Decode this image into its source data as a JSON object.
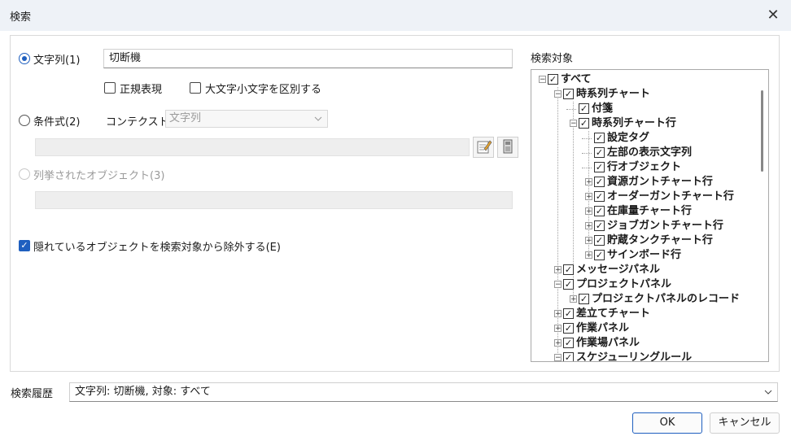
{
  "window": {
    "title": "検索",
    "close_glyph": "✕"
  },
  "search": {
    "string_label": "文字列(1)",
    "string_value": "切断機",
    "regex_label": "正規表現",
    "case_label": "大文字小文字を区別する",
    "condition_label": "条件式(2)",
    "context_label": "コンテクスト",
    "context_value": "文字列",
    "enumerated_label": "列挙されたオブジェクト(3)",
    "hidden_label": "隠れているオブジェクトを検索対象から除外する(E)"
  },
  "target": {
    "heading": "検索対象",
    "items": [
      {
        "label": "すべて",
        "level": 0,
        "expander": "minus"
      },
      {
        "label": "時系列チャート",
        "level": 1,
        "expander": "minus"
      },
      {
        "label": "付箋",
        "level": 2,
        "expander": "none"
      },
      {
        "label": "時系列チャート行",
        "level": 2,
        "expander": "minus"
      },
      {
        "label": "設定タグ",
        "level": 3,
        "expander": "none"
      },
      {
        "label": "左部の表示文字列",
        "level": 3,
        "expander": "none"
      },
      {
        "label": "行オブジェクト",
        "level": 3,
        "expander": "none"
      },
      {
        "label": "資源ガントチャート行",
        "level": 3,
        "expander": "plus"
      },
      {
        "label": "オーダーガントチャート行",
        "level": 3,
        "expander": "plus"
      },
      {
        "label": "在庫量チャート行",
        "level": 3,
        "expander": "plus"
      },
      {
        "label": "ジョブガントチャート行",
        "level": 3,
        "expander": "plus"
      },
      {
        "label": "貯蔵タンクチャート行",
        "level": 3,
        "expander": "plus"
      },
      {
        "label": "サインボード行",
        "level": 3,
        "expander": "plus"
      },
      {
        "label": "メッセージパネル",
        "level": 1,
        "expander": "plus"
      },
      {
        "label": "プロジェクトパネル",
        "level": 1,
        "expander": "minus"
      },
      {
        "label": "プロジェクトパネルのレコード",
        "level": 2,
        "expander": "plus"
      },
      {
        "label": "差立てチャート",
        "level": 1,
        "expander": "plus"
      },
      {
        "label": "作業パネル",
        "level": 1,
        "expander": "plus"
      },
      {
        "label": "作業場パネル",
        "level": 1,
        "expander": "plus"
      },
      {
        "label": "スケジューリングルール",
        "level": 1,
        "expander": "minus"
      }
    ]
  },
  "history": {
    "label": "検索履歴",
    "value": "文字列: 切断機, 対象: すべて"
  },
  "buttons": {
    "ok": "OK",
    "cancel": "キャンセル"
  },
  "colors": {
    "accent": "#1f5fbf",
    "titlebar": "#eef2f7"
  },
  "icons": {
    "edit": "edit-icon",
    "object_select": "object-select-icon",
    "dropdown": "chevron-down-icon"
  }
}
